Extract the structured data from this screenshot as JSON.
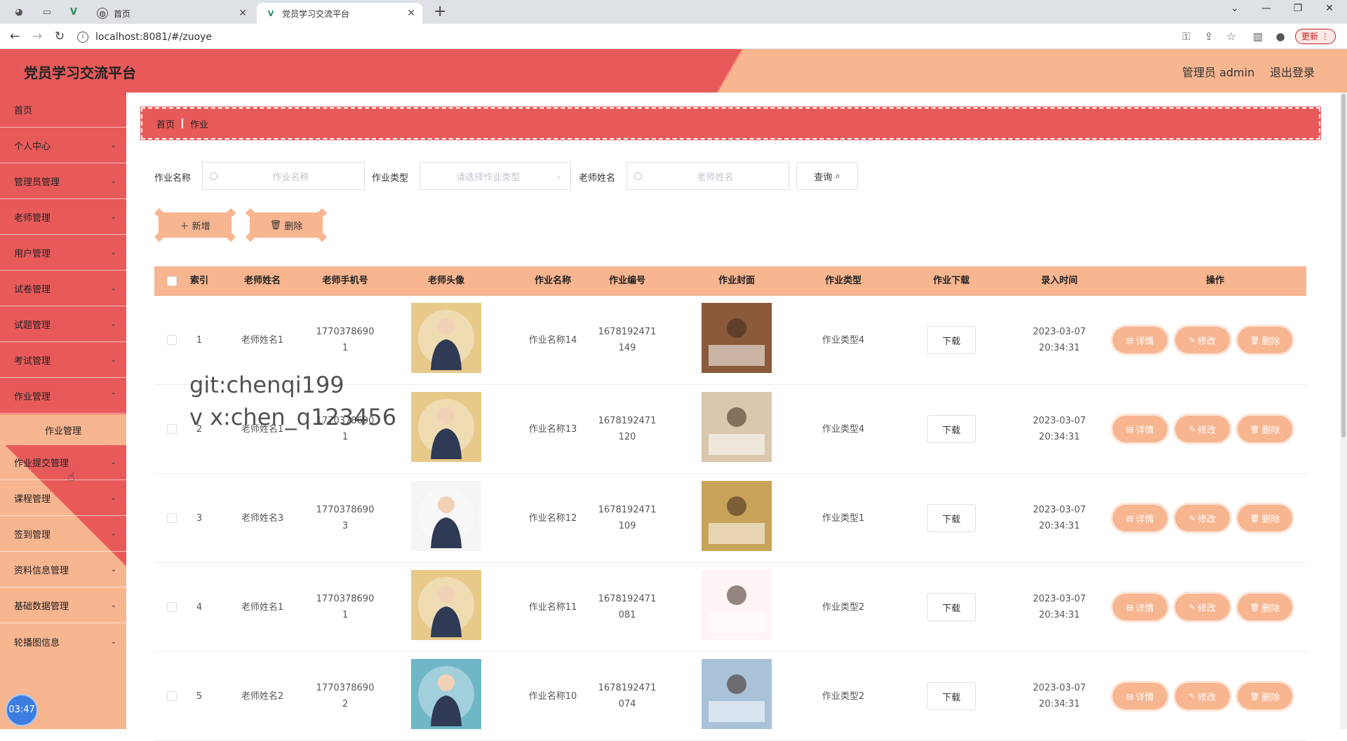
{
  "browser": {
    "tabs": [
      {
        "label": "首页"
      },
      {
        "label": "党员学习交流平台"
      }
    ],
    "url": "localhost:8081/#/zuoye",
    "update_label": "更新"
  },
  "header": {
    "title": "党员学习交流平台",
    "user": "管理员 admin",
    "logout": "退出登录"
  },
  "sidebar": {
    "items": [
      {
        "label": "首页"
      },
      {
        "label": "个人中心"
      },
      {
        "label": "管理员管理"
      },
      {
        "label": "老师管理"
      },
      {
        "label": "用户管理"
      },
      {
        "label": "试卷管理"
      },
      {
        "label": "试题管理"
      },
      {
        "label": "考试管理"
      },
      {
        "label": "作业管理"
      },
      {
        "label": "作业提交管理"
      },
      {
        "label": "课程管理"
      },
      {
        "label": "签到管理"
      },
      {
        "label": "资料信息管理"
      },
      {
        "label": "基础数据管理"
      },
      {
        "label": "轮播图信息"
      }
    ],
    "sub_item": "作业管理",
    "clock": "03:47"
  },
  "breadcrumb": {
    "home": "首页",
    "current": "作业"
  },
  "search": {
    "name_label": "作业名称",
    "name_placeholder": "作业名称",
    "type_label": "作业类型",
    "type_placeholder": "请选择作业类型",
    "teacher_label": "老师姓名",
    "teacher_placeholder": "老师姓名",
    "query_label": "查询"
  },
  "actions": {
    "add": "新增",
    "delete": "删除"
  },
  "table": {
    "headers": [
      "索引",
      "老师姓名",
      "老师手机号",
      "老师头像",
      "作业名称",
      "作业编号",
      "作业封面",
      "作业类型",
      "作业下载",
      "录入时间",
      "操作"
    ],
    "download_label": "下载",
    "op_detail": "详情",
    "op_edit": "修改",
    "op_delete": "删除",
    "rows": [
      {
        "index": "1",
        "teacher": "老师姓名1",
        "phone1": "1770378690",
        "phone2": "1",
        "name": "作业名称14",
        "code1": "1678192471",
        "code2": "149",
        "type": "作业类型4",
        "date": "2023-03-07",
        "time": "20:34:31"
      },
      {
        "index": "2",
        "teacher": "老师姓名1",
        "phone1": "1770378690",
        "phone2": "1",
        "name": "作业名称13",
        "code1": "1678192471",
        "code2": "120",
        "type": "作业类型4",
        "date": "2023-03-07",
        "time": "20:34:31"
      },
      {
        "index": "3",
        "teacher": "老师姓名3",
        "phone1": "1770378690",
        "phone2": "3",
        "name": "作业名称12",
        "code1": "1678192471",
        "code2": "109",
        "type": "作业类型1",
        "date": "2023-03-07",
        "time": "20:34:31"
      },
      {
        "index": "4",
        "teacher": "老师姓名1",
        "phone1": "1770378690",
        "phone2": "1",
        "name": "作业名称11",
        "code1": "1678192471",
        "code2": "081",
        "type": "作业类型2",
        "date": "2023-03-07",
        "time": "20:34:31"
      },
      {
        "index": "5",
        "teacher": "老师姓名2",
        "phone1": "1770378690",
        "phone2": "2",
        "name": "作业名称10",
        "code1": "1678192471",
        "code2": "074",
        "type": "作业类型2",
        "date": "2023-03-07",
        "time": "20:34:31"
      }
    ]
  },
  "watermark": {
    "line1": "git:chenqi199",
    "line2": "v x:chen_q123456"
  }
}
